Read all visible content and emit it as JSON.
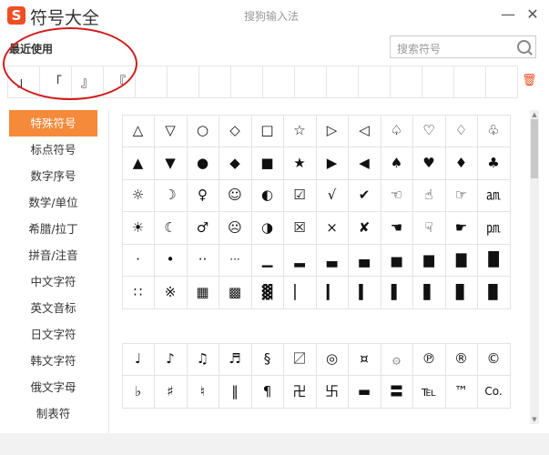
{
  "window": {
    "logo": "S",
    "app_title": "符号大全",
    "center_title": "搜狗输入法",
    "minimize": "—",
    "close": "✕"
  },
  "recent": {
    "label": "最近使用",
    "items": [
      "」",
      "「",
      "』",
      "『",
      "",
      "",
      "",
      "",
      "",
      "",
      "",
      "",
      "",
      "",
      "",
      ""
    ],
    "annotation_color": "#d21b1b"
  },
  "search": {
    "placeholder": "搜索符号"
  },
  "sidebar": {
    "items": [
      {
        "label": "特殊符号",
        "active": true
      },
      {
        "label": "标点符号"
      },
      {
        "label": "数字序号"
      },
      {
        "label": "数学/单位"
      },
      {
        "label": "希腊/拉丁"
      },
      {
        "label": "拼音/注音"
      },
      {
        "label": "中文字符"
      },
      {
        "label": "英文音标"
      },
      {
        "label": "日文字符"
      },
      {
        "label": "韩文字符"
      },
      {
        "label": "俄文字母"
      },
      {
        "label": "制表符"
      }
    ]
  },
  "symbols_group1": [
    [
      "△",
      "▽",
      "○",
      "◇",
      "□",
      "☆",
      "▷",
      "◁",
      "♤",
      "♡",
      "♢",
      "♧"
    ],
    [
      "▲",
      "▼",
      "●",
      "◆",
      "■",
      "★",
      "▶",
      "◀",
      "♠",
      "♥",
      "♦",
      "♣"
    ],
    [
      "☼",
      "☽",
      "♀",
      "☺",
      "◐",
      "☑",
      "√",
      "✔",
      "☜",
      "☝",
      "☞",
      "㏂"
    ],
    [
      "☀",
      "☾",
      "♂",
      "☹",
      "◑",
      "☒",
      "×",
      "✘",
      "☚",
      "☟",
      "☛",
      "㏘"
    ],
    [
      "·",
      "•",
      "··",
      "···",
      "▁",
      "▂",
      "▃",
      "▄",
      "▅",
      "▆",
      "▇",
      "█"
    ],
    [
      "∷",
      "※",
      "▦",
      "▩",
      "▓",
      "▏",
      "▎",
      "▍",
      "▌",
      "▋",
      "▊",
      "▉"
    ]
  ],
  "symbols_group2": [
    [
      "♩",
      "♪",
      "♫",
      "♬",
      "§",
      "〼",
      "◎",
      "¤",
      "۞",
      "℗",
      "®",
      "©"
    ],
    [
      "♭",
      "♯",
      "♮",
      "‖",
      "¶",
      "卍",
      "卐",
      "▬",
      "〓",
      "℡",
      "™",
      "Co."
    ]
  ],
  "colors": {
    "accent": "#f58a3a",
    "brand": "#f04e23"
  }
}
